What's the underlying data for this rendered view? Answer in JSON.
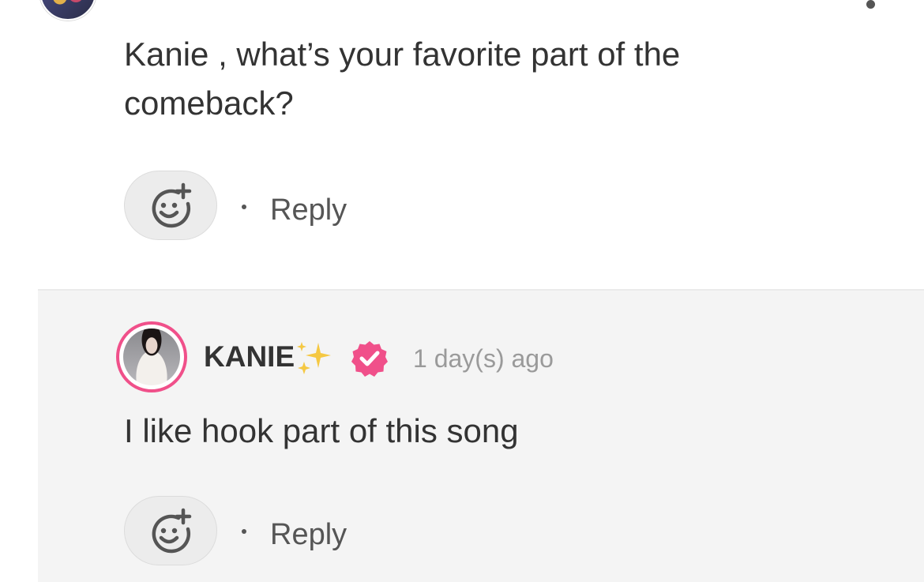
{
  "comment": {
    "text": "Kanie , what’s your favorite part of the comeback?",
    "reply_label": "Reply",
    "add_reaction_icon": "smiley-plus-icon"
  },
  "reply": {
    "author": "KANIE",
    "author_emoji": "✨",
    "verified_icon": "verified-badge-icon",
    "timestamp": "1 day(s) ago",
    "text": "I like hook part of this song",
    "reply_label": "Reply",
    "add_reaction_icon": "smiley-plus-icon"
  },
  "colors": {
    "accent_pink": "#f0508a",
    "text_primary": "#333333",
    "text_muted": "#9a9a9a",
    "reply_background": "#f4f4f4"
  }
}
